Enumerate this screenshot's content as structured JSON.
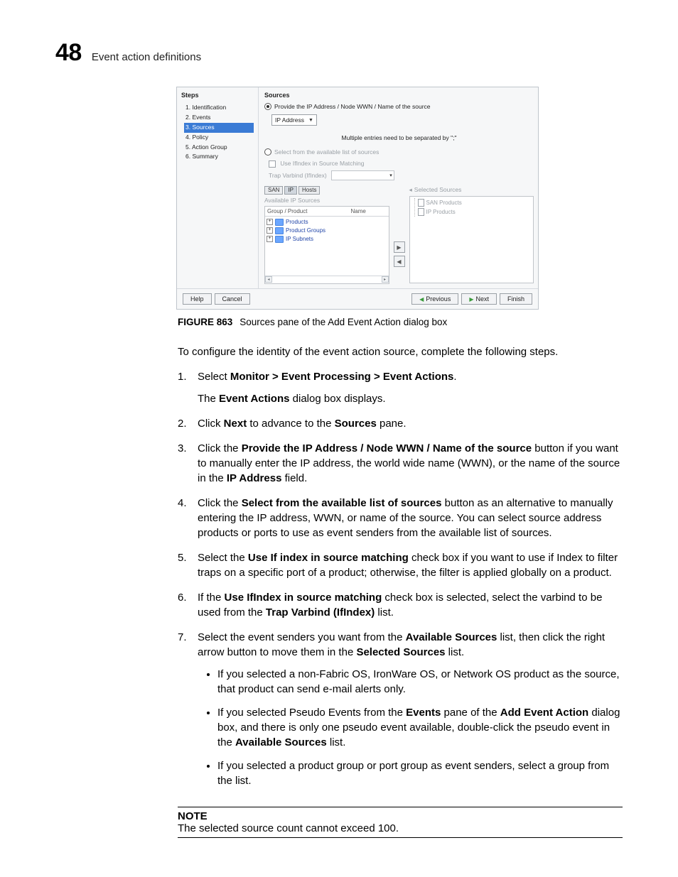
{
  "header": {
    "page_number": "48",
    "section": "Event action definitions"
  },
  "dialog": {
    "steps_title": "Steps",
    "steps": [
      "1. Identification",
      "2. Events",
      "3. Sources",
      "4. Policy",
      "5. Action Group",
      "6. Summary"
    ],
    "steps_selected_index": 2,
    "panel_title": "Sources",
    "radio_provide": "Provide the IP Address / Node WWN / Name of the source",
    "ip_dropdown": "IP Address",
    "separator_note": "Multiple entries need to be separated by \";\"",
    "radio_select": "Select from the available list of sources",
    "use_ifindex": "Use IfIndex in Source Matching",
    "trap_varbind_label": "Trap Varbind (IfIndex)",
    "tabs": [
      "SAN",
      "IP",
      "Hosts"
    ],
    "available_label": "Available IP Sources",
    "columns": {
      "group_product": "Group / Product",
      "name": "Name"
    },
    "tree": [
      "Products",
      "Product Groups",
      "IP Subnets"
    ],
    "selected_title": "Selected Sources",
    "selected_tree": [
      "SAN Products",
      "IP Products"
    ],
    "footer": {
      "help": "Help",
      "cancel": "Cancel",
      "previous": "Previous",
      "next": "Next",
      "finish": "Finish"
    }
  },
  "caption": {
    "figure": "FIGURE 863",
    "text": "Sources pane of the Add Event Action dialog box"
  },
  "intro": "To configure the identity of the event action source, complete the following steps.",
  "instructions": {
    "s1": {
      "a": "Select ",
      "b": "Monitor > Event Processing > Event Actions",
      "c": ".",
      "sub_a": "The ",
      "sub_b": "Event Actions",
      "sub_c": " dialog box displays."
    },
    "s2": {
      "a": "Click ",
      "b": "Next",
      "c": " to advance to the ",
      "d": "Sources",
      "e": " pane."
    },
    "s3": {
      "a": "Click the ",
      "b": "Provide the IP Address / Node WWN / Name of the source",
      "c": " button if you want to manually enter the IP address, the world wide name (WWN), or the name of the source in the ",
      "d": "IP Address",
      "e": " field."
    },
    "s4": {
      "a": "Click the ",
      "b": "Select from the available list of sources",
      "c": " button as an alternative to manually entering the IP address, WWN, or name of the source. You can select source address products or ports to use as event senders from the available list of sources."
    },
    "s5": {
      "a": "Select the ",
      "b": "Use If index in source matching",
      "c": " check box if you want to use if Index to filter traps on a specific port of a product; otherwise, the filter is applied globally on a product."
    },
    "s6": {
      "a": "If the ",
      "b": "Use IfIndex in source matching",
      "c": " check box is selected, select the varbind to be used from the ",
      "d": "Trap Varbind (IfIndex)",
      "e": " list."
    },
    "s7": {
      "a": "Select the event senders you want from the ",
      "b": "Available Sources",
      "c": " list, then click the right arrow button to move them in the ",
      "d": "Selected Sources",
      "e": " list.",
      "bul1": "If you selected a non-Fabric OS, IronWare OS, or Network OS product as the source, that product can send e-mail alerts only.",
      "bul2_a": "If you selected Pseudo Events from the ",
      "bul2_b": "Events",
      "bul2_c": " pane of the ",
      "bul2_d": "Add Event Action",
      "bul2_e": " dialog box, and there is only one pseudo event available, double-click the pseudo event in the ",
      "bul2_f": "Available Sources",
      "bul2_g": " list.",
      "bul3": "If you selected a product group or port group as event senders, select a group from the list."
    }
  },
  "note": {
    "label": "NOTE",
    "text": "The selected source count cannot exceed 100."
  }
}
